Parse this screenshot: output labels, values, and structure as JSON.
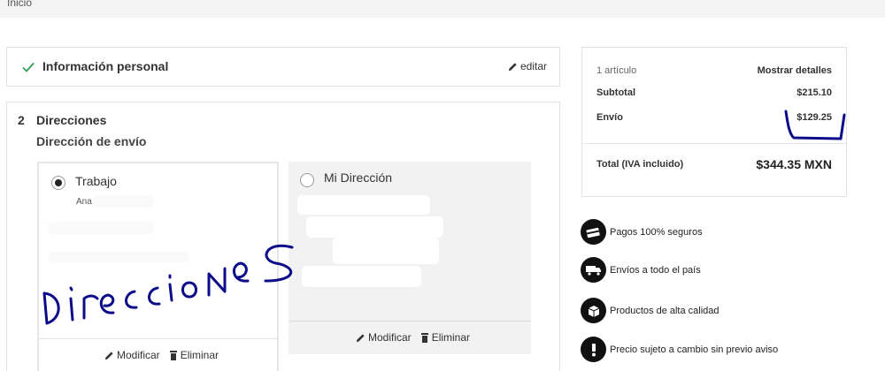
{
  "breadcrumb": {
    "label": "Inicio"
  },
  "personal": {
    "title": "Información personal",
    "edit_label": "editar"
  },
  "addresses": {
    "step": "2",
    "title": "Direcciones",
    "shipping_title": "Dirección de envío",
    "cards": [
      {
        "name": "Trabajo",
        "line1": "Ana",
        "modify": "Modificar",
        "remove": "Eliminar"
      },
      {
        "name": "Mi Dirección",
        "modify": "Modificar",
        "remove": "Eliminar"
      }
    ]
  },
  "summary": {
    "items_count": "1 artículo",
    "details_link": "Mostrar detalles",
    "subtotal_label": "Subtotal",
    "subtotal_value": "$215.10",
    "shipping_label": "Envío",
    "shipping_value": "$129.25",
    "total_label": "Total (IVA incluido)",
    "total_value": "$344.35 MXN"
  },
  "features": [
    {
      "label": "Pagos 100% seguros",
      "icon": "secure-payment-icon"
    },
    {
      "label": "Envíos a todo el país",
      "icon": "truck-icon"
    },
    {
      "label": "Productos de alta calidad",
      "icon": "box-icon"
    },
    {
      "label": "Precio sujeto a cambio sin previo aviso",
      "icon": "exclamation-icon"
    }
  ],
  "annotation": {
    "text": "Direcciones",
    "color": "#0c0c8a"
  },
  "colors": {
    "check": "#2e9e4f",
    "ink": "#0c0c8a"
  }
}
